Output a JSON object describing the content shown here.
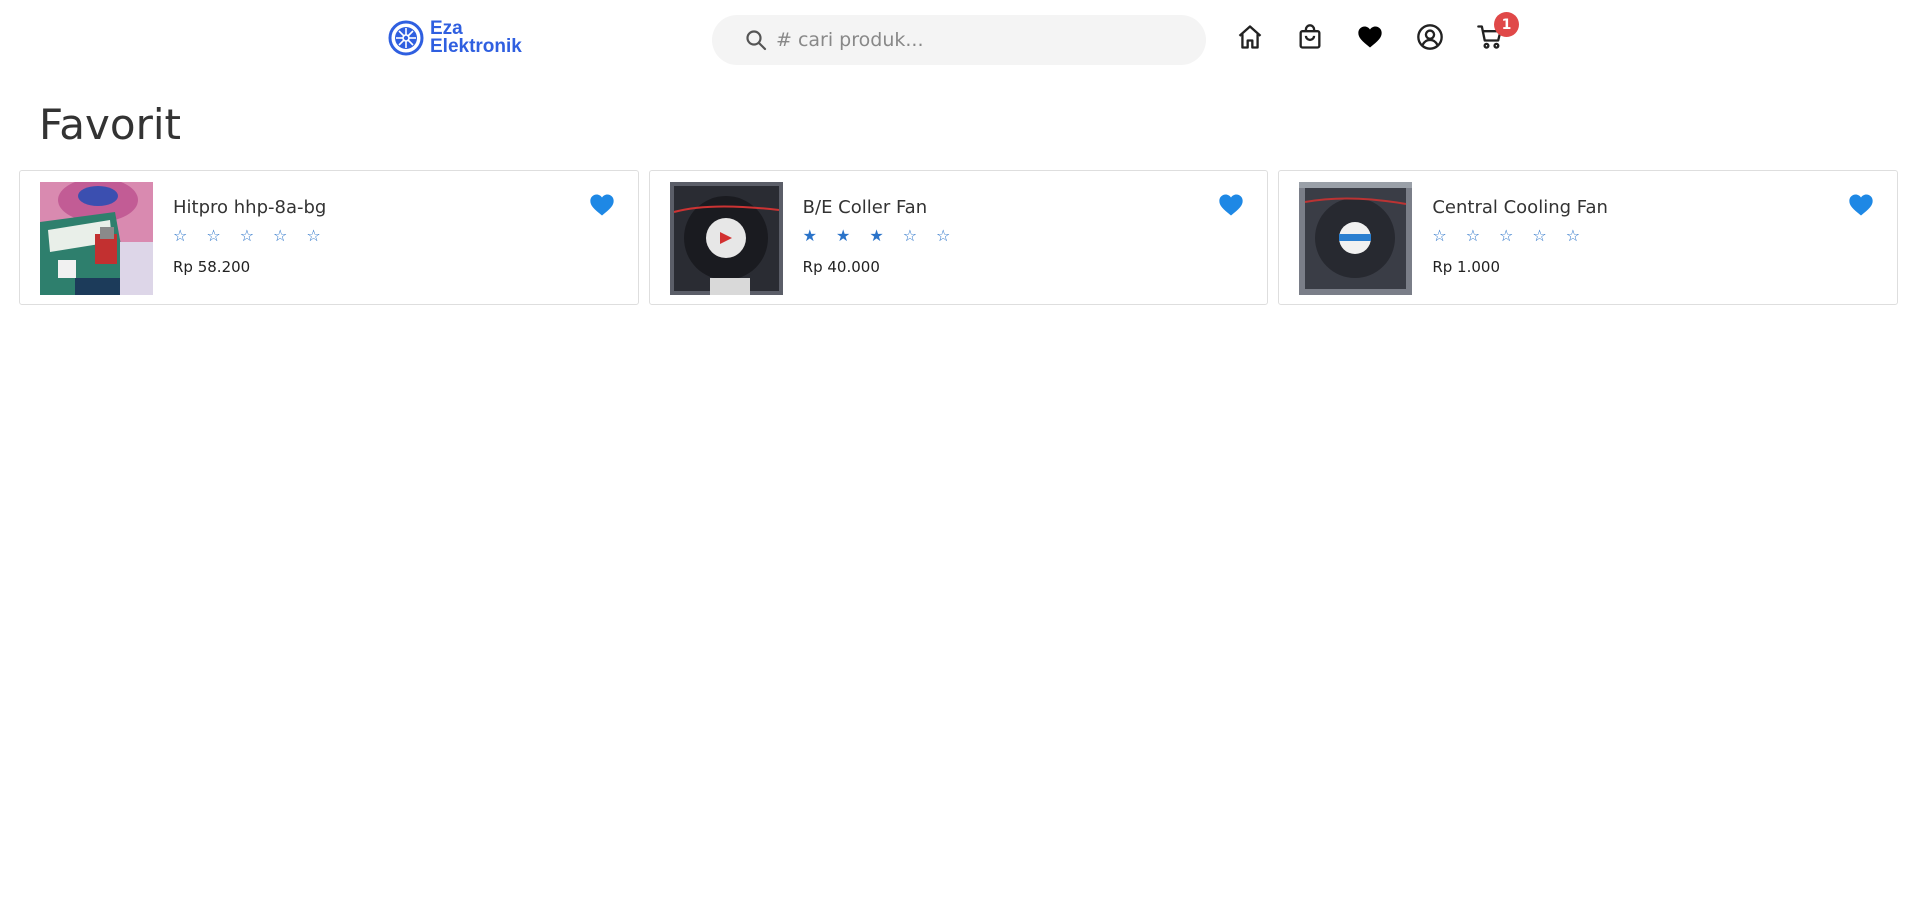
{
  "brand": {
    "line1": "Eza",
    "line2": "Elektronik",
    "color": "#2f5fe0"
  },
  "search": {
    "placeholder": "# cari produk..."
  },
  "nav": {
    "icons": [
      "home-icon",
      "shopping-bag-icon",
      "heart-icon",
      "user-circle-icon",
      "cart-icon"
    ],
    "cart_count": "1"
  },
  "page": {
    "title": "Favorit"
  },
  "favorites": [
    {
      "name": "Hitpro hhp-8a-bg",
      "rating": 0,
      "price": "Rp 58.200"
    },
    {
      "name": "B/E Coller Fan",
      "rating": 3,
      "price": "Rp 40.000"
    },
    {
      "name": "Central Cooling Fan",
      "rating": 0,
      "price": "Rp 1.000"
    }
  ],
  "colors": {
    "accent": "#1e88e5",
    "badge": "#e04848",
    "star": "#2a73c9"
  }
}
